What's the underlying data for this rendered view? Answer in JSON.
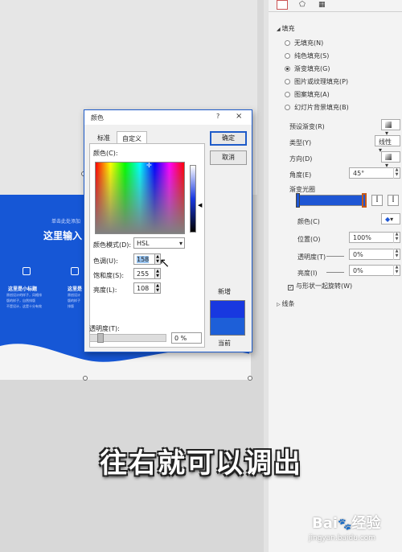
{
  "slide": {
    "click_add": "单击此处添加",
    "headline": "这里输入",
    "feature1_title": "这里是小标题",
    "feature1_text_line1": "原创设计的样子，风格排",
    "feature1_text_line2": "版的样子，自然排版",
    "feature1_text_line3": "不是设计，这是十分有效",
    "feature2_title": "这里是",
    "feature2_text_line1": "原创设计",
    "feature2_text_line2": "版的样子",
    "feature2_text_line3": "排版"
  },
  "pane": {
    "tabs": [
      "fill-line-tab",
      "effects-tab",
      "size-tab"
    ],
    "section_fill": "填充",
    "fill_options": [
      {
        "label": "无填充(N)",
        "selected": false
      },
      {
        "label": "纯色填充(S)",
        "selected": false
      },
      {
        "label": "渐变填充(G)",
        "selected": true
      },
      {
        "label": "图片或纹理填充(P)",
        "selected": false
      },
      {
        "label": "图案填充(A)",
        "selected": false
      },
      {
        "label": "幻灯片背景填充(B)",
        "selected": false
      }
    ],
    "preset_label": "预设渐变(R)",
    "type_label": "类型(Y)",
    "type_value": "线性",
    "direction_label": "方向(D)",
    "angle_label": "角度(E)",
    "angle_value": "45°",
    "stops_label": "渐变光圈",
    "color_label": "颜色(C)",
    "position_label": "位置(O)",
    "position_value": "100%",
    "transparency_label": "透明度(T)",
    "transparency_value": "0%",
    "brightness_label": "亮度(I)",
    "brightness_value": "0%",
    "rotate_label": "与形状一起旋转(W)",
    "section_line": "线条",
    "gradient_start_color": "#1e56d4",
    "gradient_end_color": "#1e56d4"
  },
  "dialog": {
    "title": "颜色",
    "help": "?",
    "close": "×",
    "tab_standard": "标准",
    "tab_custom": "自定义",
    "colors_label": "颜色(C):",
    "mode_label": "颜色模式(D):",
    "mode_value": "HSL",
    "hue_label": "色调(U):",
    "hue_value": "158",
    "sat_label": "饱和度(S):",
    "sat_value": "255",
    "lum_label": "亮度(L):",
    "lum_value": "108",
    "transparency_label": "透明度(T):",
    "transparency_value": "0 %",
    "ok": "确定",
    "cancel": "取消",
    "new_label": "新增",
    "current_label": "当前",
    "new_color": "#1838e0",
    "current_color": "#1d5fd8"
  },
  "caption": "往右就可以调出",
  "watermark": {
    "brand": "Bai",
    "brand2": "经验",
    "url": "jingyan.baidu.com"
  }
}
